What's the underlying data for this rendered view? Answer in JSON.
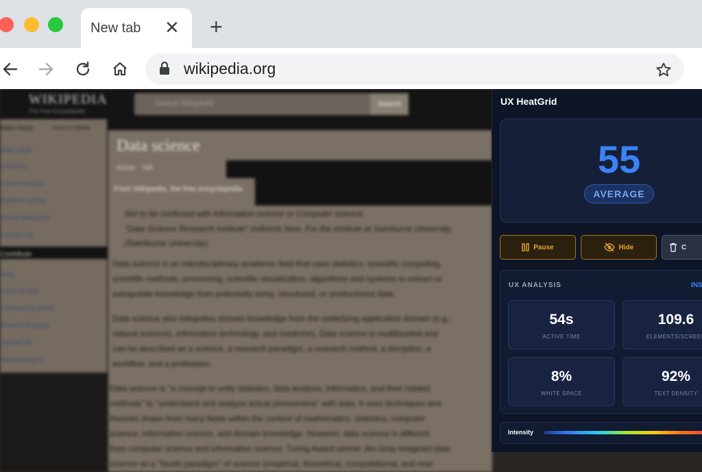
{
  "browser": {
    "tab_title": "New tab",
    "tab_close": "✕",
    "new_tab": "+",
    "url": "wikipedia.org"
  },
  "wiki": {
    "logo": "WIKIPEDIA",
    "tagline": "The Free Encyclopedia",
    "search_placeholder": "Search Wikipedia",
    "search_button": "Search",
    "sidebar": {
      "main_menu": "Main menu",
      "move_label": "move to sidebar",
      "items": [
        "Main page",
        "Contents",
        "Current events",
        "Random article",
        "About Wikipedia",
        "Contact us"
      ],
      "contribute": "Contribute",
      "contribute_items": [
        "Help",
        "Learn to edit",
        "Community portal",
        "Recent changes",
        "Upload file",
        "Special pages"
      ]
    },
    "title": "Data science",
    "tabs": [
      "Article",
      "Talk"
    ],
    "from": "From Wikipedia, the free encyclopedia",
    "lines": [
      "Not to be confused with Information science or Computer science.",
      "\"Data Science Research Institute\" redirects here. For the institute at Swinburne University,",
      "(Swinburne University).",
      "Data science is an interdisciplinary academic field that uses statistics, scientific computing,",
      "scientific methods, processing, scientific visualization, algorithms and systems to extract or",
      "extrapolate knowledge from potentially noisy, structured, or unstructured data.",
      "Data science also integrates domain knowledge from the underlying application domain (e.g.,",
      "natural sciences, information technology, and medicine). Data science is multifaceted and",
      "can be described as a science, a research paradigm, a research method, a discipline, a",
      "workflow, and a profession.",
      "Data science is \"a concept to unify statistics, data analysis, informatics, and their related",
      "methods\" to \"understand and analyze actual phenomena\" with data. It uses techniques and",
      "theories drawn from many fields within the context of mathematics, statistics, computer",
      "science, information science, and domain knowledge. However, data science is different",
      "from computer science and information science. Turing Award winner Jim Gray imagined data",
      "science as a \"fourth paradigm\" of science (empirical, theoretical, computational, and now"
    ]
  },
  "panel": {
    "title": "UX HeatGrid",
    "score": "55",
    "score_label": "AVERAGE",
    "buttons": {
      "pause": "Pause",
      "hide": "Hide",
      "clear": "C"
    },
    "analysis_title": "UX ANALYSIS",
    "analysis_link": "INS",
    "metrics": [
      {
        "value": "54s",
        "label": "ACTIVE TIME"
      },
      {
        "value": "109.6",
        "label": "ELEMENTS/SCREEN"
      },
      {
        "value": "8%",
        "label": "WHITE SPACE"
      },
      {
        "value": "92%",
        "label": "TEXT DENSITY"
      }
    ],
    "intensity_label": "Intensity"
  },
  "colors": {
    "accent_blue": "#3b82f6",
    "warning_amber": "#e3a33b",
    "panel_bg": "#0d1526"
  },
  "icons": [
    "back-arrow-icon",
    "forward-arrow-icon",
    "reload-icon",
    "home-icon",
    "lock-icon",
    "star-icon",
    "pause-icon",
    "eye-off-icon",
    "trash-icon"
  ]
}
